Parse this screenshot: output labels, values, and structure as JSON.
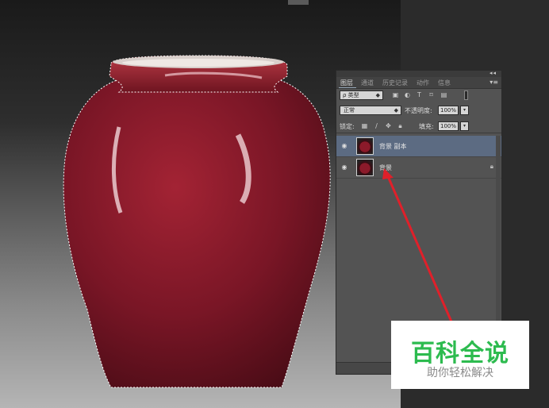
{
  "panel": {
    "collapse_label": "◂◂",
    "close_label": "×",
    "menu_label": "▾≡",
    "tabs": [
      "图层",
      "通道",
      "历史记录",
      "动作",
      "信息"
    ],
    "filter": {
      "kind_label": "ρ 类型",
      "icons": [
        "image-filter-icon",
        "adjustment-filter-icon",
        "type-filter-icon",
        "shape-filter-icon",
        "smart-object-filter-icon"
      ]
    },
    "blend": {
      "mode": "正常",
      "opacity_label": "不透明度:",
      "opacity_value": "100%"
    },
    "lock": {
      "label": "锁定:",
      "fill_label": "填充:",
      "fill_value": "100%"
    },
    "layers": [
      {
        "name": "背景 副本",
        "selected": true,
        "visible": true,
        "locked": false
      },
      {
        "name": "背景",
        "selected": false,
        "visible": true,
        "locked": true
      }
    ]
  },
  "watermark": {
    "title": "百科全说",
    "subtitle": "助你轻松解决",
    "title_color": "#2dbb4f"
  },
  "colors": {
    "selected_layer": "#5c6b82",
    "panel_bg": "#535353",
    "vase": "#8b1a2a",
    "arrow": "#e0202a"
  }
}
